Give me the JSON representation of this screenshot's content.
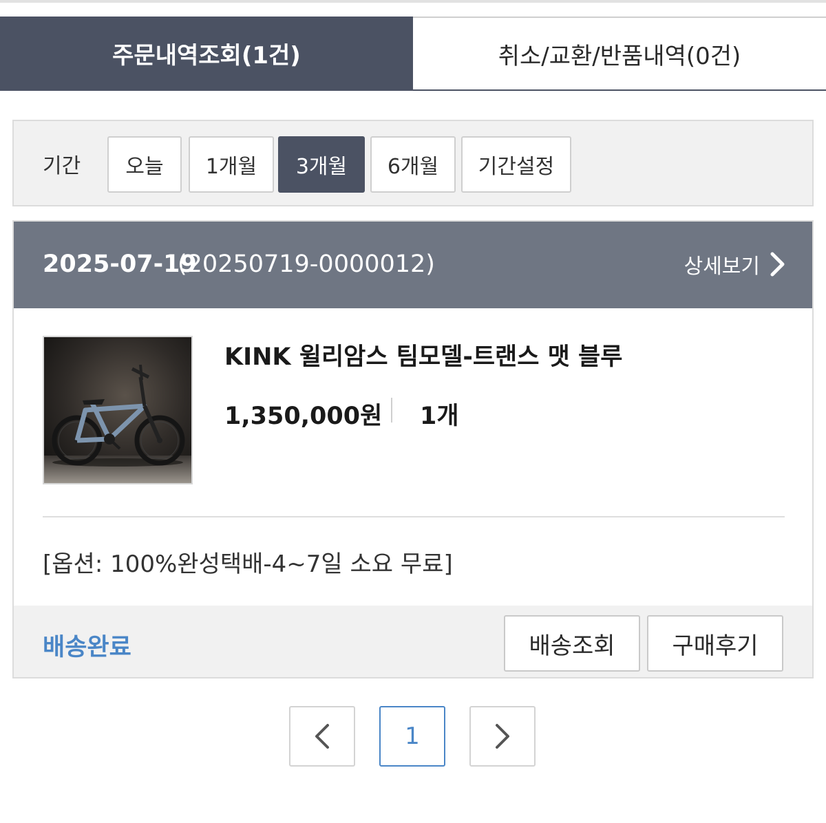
{
  "tabs": {
    "orders_label": "주문내역조회(1건)",
    "returns_label": "취소/교환/반품내역(0건)"
  },
  "period": {
    "label": "기간",
    "options": [
      "오늘",
      "1개월",
      "3개월",
      "6개월",
      "기간설정"
    ],
    "selected": "3개월"
  },
  "order": {
    "date": "2025-07-19",
    "order_number": "(20250719-0000012)",
    "detail_label": "상세보기",
    "product_name": "KINK 윌리암스 팀모델-트랜스 맷 블루",
    "price": "1,350,000원",
    "quantity": "1개",
    "option": "[옵션: 100%완성택배-4~7일 소요 무료]",
    "status": "배송완료",
    "track_label": "배송조회",
    "review_label": "구매후기"
  },
  "pagination": {
    "current_page": "1"
  },
  "colors": {
    "dark_slate": "#4b5263",
    "header_gray": "#6f7683",
    "status_blue": "#4a86c7",
    "panel_bg": "#f1f1f1"
  },
  "icons": {
    "detail": "chevron-right-icon",
    "prev": "chevron-left-icon",
    "next": "chevron-right-icon",
    "product_image": "bmx-bike-photo"
  }
}
